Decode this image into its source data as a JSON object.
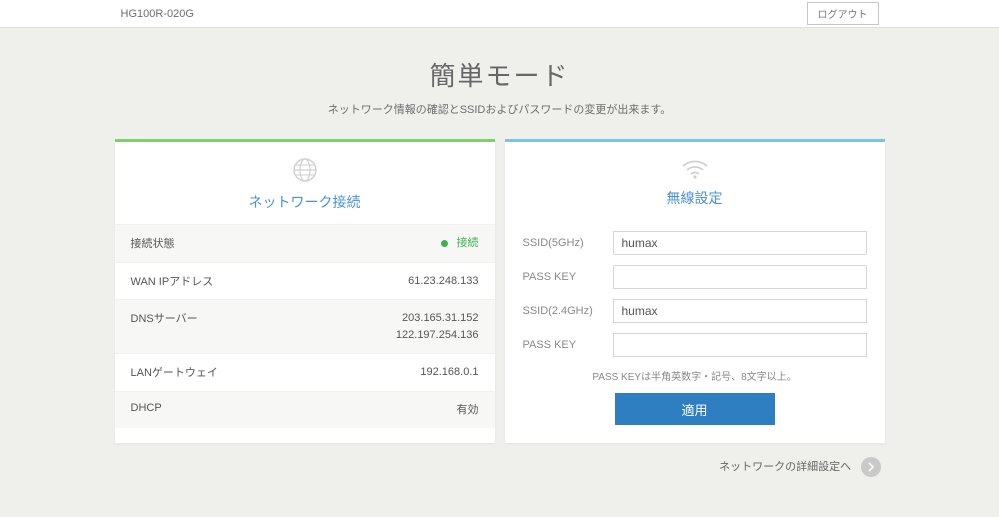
{
  "header": {
    "model": "HG100R-020G",
    "logout_label": "ログアウト"
  },
  "page": {
    "title": "簡単モード",
    "subtitle": "ネットワーク情報の確認とSSIDおよびパスワードの変更が出来ます。"
  },
  "network_panel": {
    "title": "ネットワーク接続",
    "rows": {
      "status": {
        "label": "接続状態",
        "value": "接続"
      },
      "wan_ip": {
        "label": "WAN IPアドレス",
        "value": "61.23.248.133"
      },
      "dns": {
        "label": "DNSサーバー",
        "value": "203.165.31.152\n122.197.254.136"
      },
      "lan_gw": {
        "label": "LANゲートウェイ",
        "value": "192.168.0.1"
      },
      "dhcp": {
        "label": "DHCP",
        "value": "有効"
      }
    }
  },
  "wireless_panel": {
    "title": "無線設定",
    "fields": {
      "ssid5": {
        "label": "SSID(5GHz)",
        "value": "humax"
      },
      "passkey5": {
        "label": "PASS KEY",
        "value": ""
      },
      "ssid24": {
        "label": "SSID(2.4GHz)",
        "value": "humax"
      },
      "passkey24": {
        "label": "PASS KEY",
        "value": ""
      }
    },
    "hint": "PASS KEYは半角英数字・記号、8文字以上。",
    "apply_label": "適用"
  },
  "footer": {
    "advanced_label": "ネットワークの詳細設定へ"
  },
  "colors": {
    "network_accent": "#7fcf6a",
    "wireless_accent": "#7dc2e8",
    "primary_button": "#2d7fc1",
    "status_ok": "#3fb24f",
    "link_blue": "#4a90d9"
  }
}
